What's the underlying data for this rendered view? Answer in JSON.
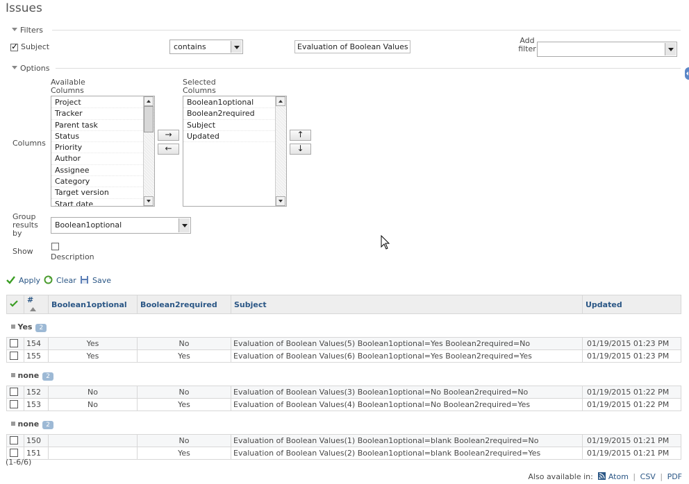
{
  "page": {
    "title": "Issues"
  },
  "filters": {
    "legend": "Filters",
    "subject_label": "Subject",
    "operator": "contains",
    "value": "Evaluation of Boolean Values",
    "add_filter_label_1": "Add",
    "add_filter_label_2": "filter",
    "add_filter_value": ""
  },
  "options": {
    "legend": "Options",
    "columns_label": "Columns",
    "available_label_1": "Available",
    "available_label_2": "Columns",
    "selected_label_1": "Selected",
    "selected_label_2": "Columns",
    "available_columns": [
      "Project",
      "Tracker",
      "Parent task",
      "Status",
      "Priority",
      "Author",
      "Assignee",
      "Category",
      "Target version",
      "Start date"
    ],
    "selected_columns": [
      "Boolean1optional",
      "Boolean2required",
      "Subject",
      "Updated"
    ],
    "btn_add": "→",
    "btn_remove": "←",
    "btn_up": "↑",
    "btn_down": "↓",
    "group_by_label_1": "Group",
    "group_by_label_2": "results",
    "group_by_label_3": "by",
    "group_by_value": "Boolean1optional",
    "show_label": "Show",
    "description_label": "Description"
  },
  "actions": {
    "apply": "Apply",
    "clear": "Clear",
    "save": "Save"
  },
  "table": {
    "headers": {
      "id": "#",
      "b1": "Boolean1optional",
      "b2": "Boolean2required",
      "subject": "Subject",
      "updated": "Updated"
    },
    "groups": [
      {
        "name": "Yes",
        "count": "2",
        "rows": [
          {
            "id": "154",
            "b1": "Yes",
            "b2": "No",
            "subject": "Evaluation of Boolean Values(5) Boolean1optional=Yes Boolean2required=No",
            "updated": "01/19/2015 01:23 PM"
          },
          {
            "id": "155",
            "b1": "Yes",
            "b2": "Yes",
            "subject": "Evaluation of Boolean Values(6) Boolean1optional=Yes Boolean2required=Yes",
            "updated": "01/19/2015 01:23 PM"
          }
        ]
      },
      {
        "name": "none",
        "count": "2",
        "rows": [
          {
            "id": "152",
            "b1": "No",
            "b2": "No",
            "subject": "Evaluation of Boolean Values(3) Boolean1optional=No Boolean2required=No",
            "updated": "01/19/2015 01:22 PM"
          },
          {
            "id": "153",
            "b1": "No",
            "b2": "Yes",
            "subject": "Evaluation of Boolean Values(4) Boolean1optional=No Boolean2required=Yes",
            "updated": "01/19/2015 01:22 PM"
          }
        ]
      },
      {
        "name": "none",
        "count": "2",
        "rows": [
          {
            "id": "150",
            "b1": "",
            "b2": "No",
            "subject": "Evaluation of Boolean Values(1) Boolean1optional=blank Boolean2required=No",
            "updated": "01/19/2015 01:21 PM"
          },
          {
            "id": "151",
            "b1": "",
            "b2": "Yes",
            "subject": "Evaluation of Boolean Values(2) Boolean1optional=blank Boolean2required=Yes",
            "updated": "01/19/2015 01:21 PM"
          }
        ]
      }
    ]
  },
  "pagination": "(1-6/6)",
  "footer": {
    "also_available": "Also available in:",
    "atom": "Atom",
    "sep1": "|",
    "csv": "CSV",
    "sep2": "|",
    "pdf": "PDF"
  }
}
